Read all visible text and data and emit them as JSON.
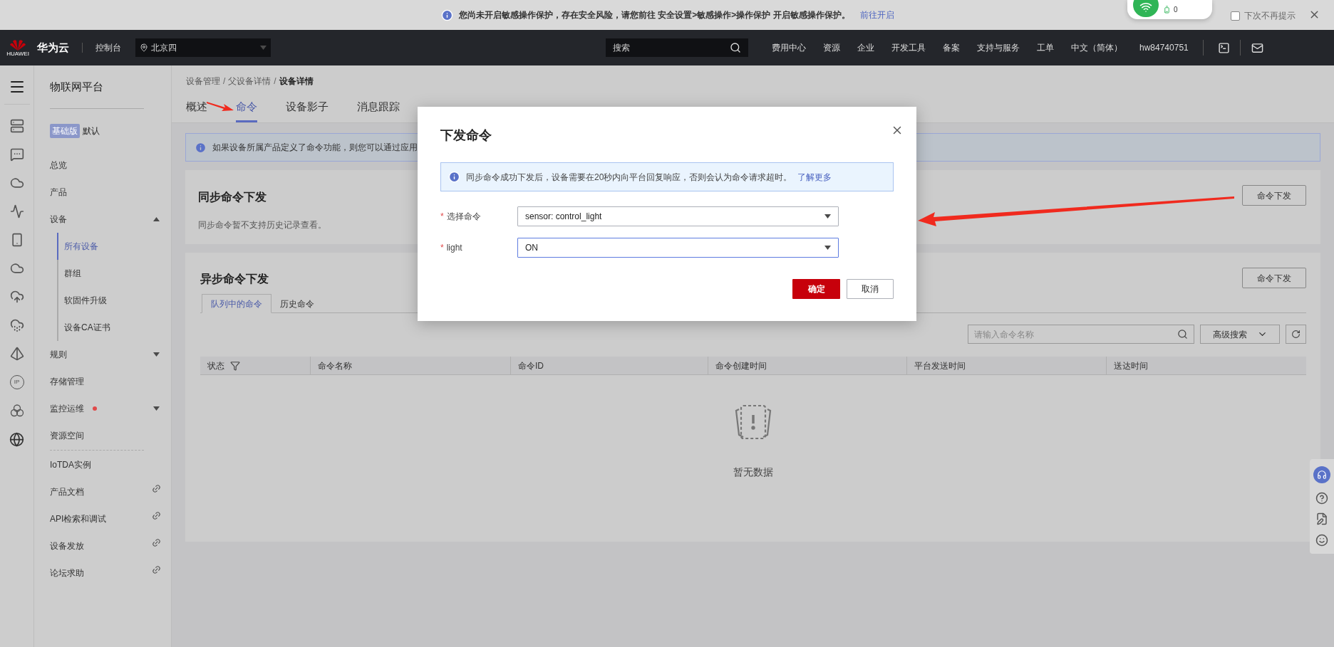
{
  "notice": {
    "text": "您尚未开启敏感操作保护，存在安全风险，请您前往 安全设置>敏感操作>操作保护 开启敏感操作保护。",
    "link": "前往开启",
    "dont_show_again": {
      "label": "下次不再提示",
      "checked": false
    }
  },
  "widget": {
    "reading": "0"
  },
  "header": {
    "logo_text": "HUAWEI",
    "brand": "华为云",
    "console": "控制台",
    "region": "北京四",
    "search_placeholder": "搜索",
    "links": [
      "费用中心",
      "资源",
      "企业",
      "开发工具",
      "备案",
      "支持与服务",
      "工单",
      "中文（简体）",
      "hw84740751"
    ]
  },
  "rail": {
    "ip_label": "IP"
  },
  "sidebar": {
    "title": "物联网平台",
    "edition_badge": "基础版",
    "edition_label": "默认",
    "items": [
      {
        "label": "总览",
        "kind": "link"
      },
      {
        "label": "产品",
        "kind": "link"
      },
      {
        "label": "设备",
        "kind": "group",
        "expanded": true,
        "alert": false,
        "children": [
          {
            "label": "所有设备",
            "selected": true
          },
          {
            "label": "群组",
            "selected": false
          },
          {
            "label": "软固件升级",
            "selected": false
          },
          {
            "label": "设备CA证书",
            "selected": false
          }
        ]
      },
      {
        "label": "规则",
        "kind": "group",
        "expanded": false,
        "alert": false
      },
      {
        "label": "存储管理",
        "kind": "link"
      },
      {
        "label": "监控运维",
        "kind": "group",
        "expanded": false,
        "alert": true
      },
      {
        "label": "资源空间",
        "kind": "link"
      },
      {
        "kind": "divider"
      },
      {
        "label": "IoTDA实例",
        "kind": "link"
      },
      {
        "label": "产品文档",
        "kind": "external"
      },
      {
        "label": "API检索和调试",
        "kind": "external"
      },
      {
        "label": "设备发放",
        "kind": "external"
      },
      {
        "label": "论坛求助",
        "kind": "external"
      }
    ]
  },
  "breadcrumb": {
    "separator": "/",
    "items": [
      "设备管理",
      "父设备详情",
      "设备详情"
    ]
  },
  "tabs": [
    {
      "label": "概述",
      "selected": false
    },
    {
      "label": "命令",
      "selected": true
    },
    {
      "label": "设备影子",
      "selected": false
    },
    {
      "label": "消息跟踪",
      "selected": false
    }
  ],
  "info_text": "如果设备所属产品定义了命令功能，则您可以通过应用",
  "sync_section": {
    "title": "同步命令下发",
    "note": "同步命令暂不支持历史记录查看。",
    "button": "命令下发"
  },
  "async_section": {
    "title": "异步命令下发",
    "button": "命令下发",
    "subtabs": [
      {
        "label": "队列中的命令",
        "selected": true
      },
      {
        "label": "历史命令",
        "selected": false
      }
    ],
    "search_placeholder": "请输入命令名称",
    "advanced_search": "高级搜索",
    "table": {
      "columns": [
        {
          "label": "状态",
          "filter": true
        },
        {
          "label": "命令名称",
          "filter": false
        },
        {
          "label": "命令ID",
          "filter": false
        },
        {
          "label": "命令创建时间",
          "filter": false
        },
        {
          "label": "平台发送时间",
          "filter": false
        },
        {
          "label": "送达时间",
          "filter": false
        }
      ]
    },
    "empty_text": "暂无数据"
  },
  "dialog": {
    "title": "下发命令",
    "info": "同步命令成功下发后，设备需要在20秒内向平台回复响应，否则会认为命令请求超时。",
    "info_link": "了解更多",
    "fields": [
      {
        "label": "选择命令",
        "required": true,
        "value": "sensor: control_light",
        "focused": false
      },
      {
        "label": "light",
        "required": true,
        "value": "ON",
        "focused": true
      }
    ],
    "required_mark": "*",
    "confirm": "确定",
    "cancel": "取消"
  }
}
